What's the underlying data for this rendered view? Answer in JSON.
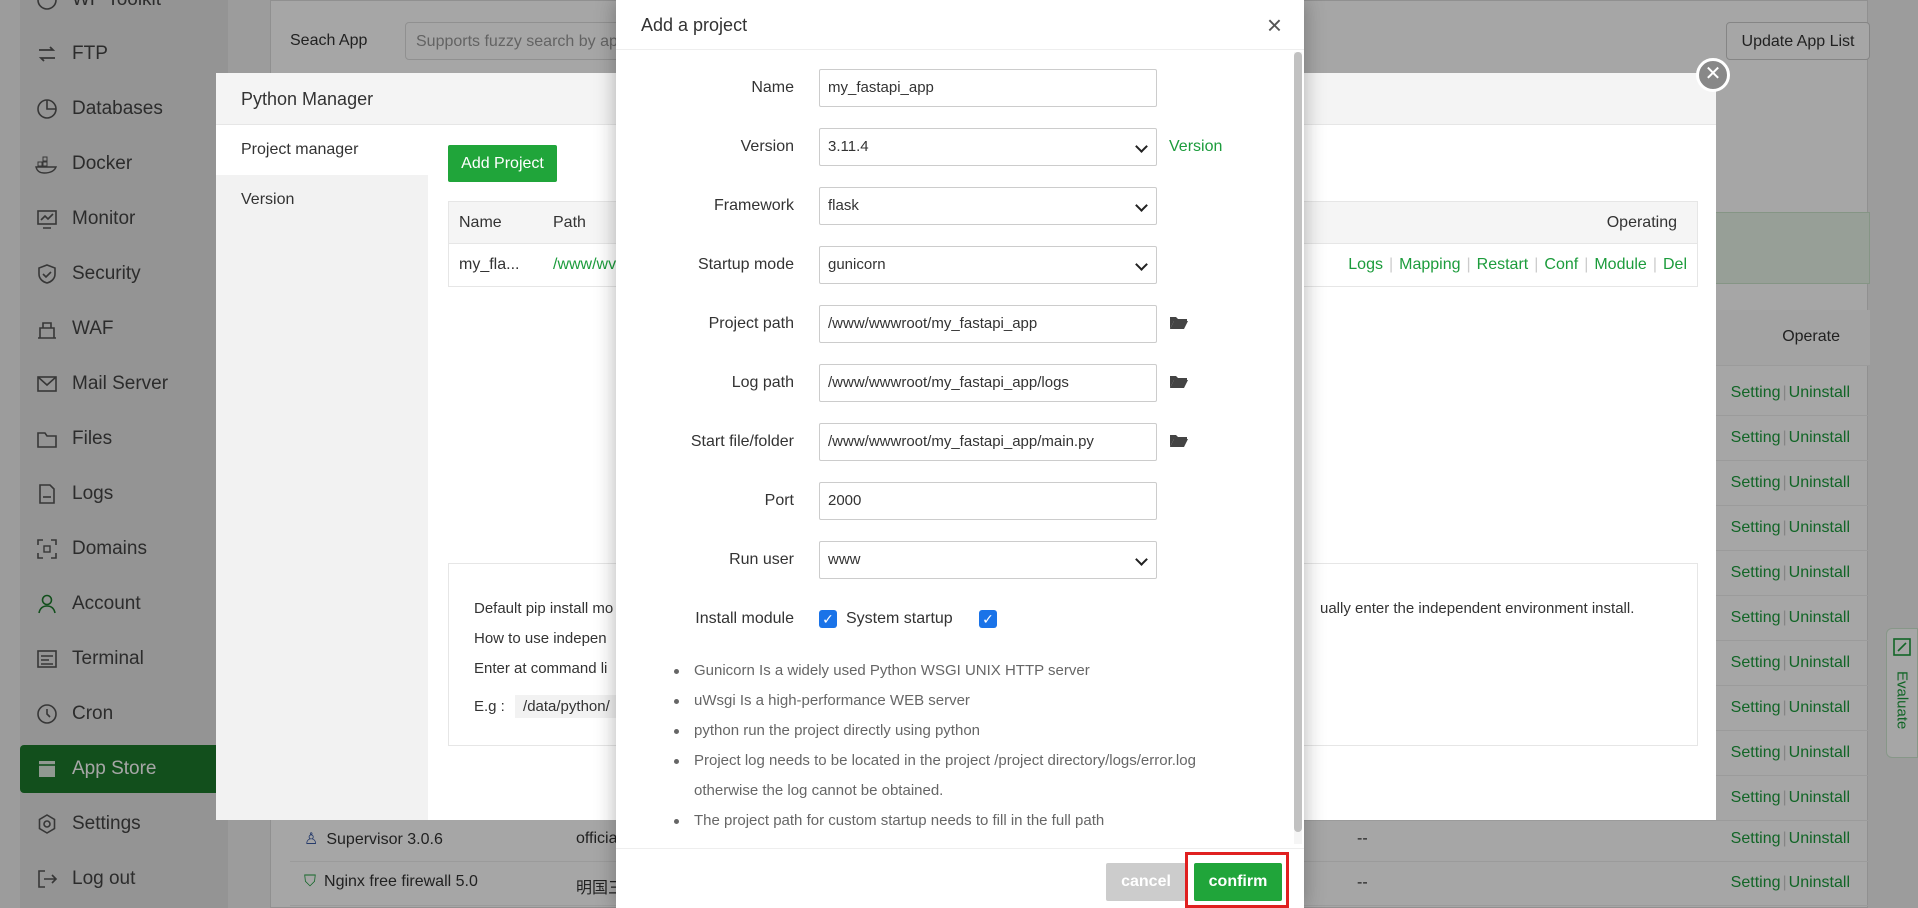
{
  "sidebar": {
    "items": [
      {
        "label": "WP Toolkit",
        "icon": "wordpress-icon"
      },
      {
        "label": "FTP",
        "icon": "ftp-icon"
      },
      {
        "label": "Databases",
        "icon": "database-icon"
      },
      {
        "label": "Docker",
        "icon": "docker-icon"
      },
      {
        "label": "Monitor",
        "icon": "monitor-icon"
      },
      {
        "label": "Security",
        "icon": "shield-icon"
      },
      {
        "label": "WAF",
        "icon": "waf-icon"
      },
      {
        "label": "Mail Server",
        "icon": "mail-icon"
      },
      {
        "label": "Files",
        "icon": "folder-icon"
      },
      {
        "label": "Logs",
        "icon": "logs-icon"
      },
      {
        "label": "Domains",
        "icon": "domains-icon"
      },
      {
        "label": "Account",
        "icon": "user-icon"
      },
      {
        "label": "Terminal",
        "icon": "terminal-icon"
      },
      {
        "label": "Cron",
        "icon": "clock-icon"
      },
      {
        "label": "App Store",
        "icon": "store-icon",
        "active": true
      },
      {
        "label": "Settings",
        "icon": "gear-icon"
      },
      {
        "label": "Log out",
        "icon": "logout-icon"
      }
    ]
  },
  "appstore": {
    "search_label": "Seach App",
    "search_placeholder": "Supports fuzzy search by ap",
    "update_label": "Update App List",
    "operate_header": "Operate",
    "setting_label": "Setting",
    "uninstall_label": "Uninstall",
    "rows": [
      {
        "name": "Supervisor 3.0.6",
        "dev": "officia",
        "status": "--"
      },
      {
        "name": "Nginx free firewall 5.0",
        "dev": "明国三",
        "status": "--"
      }
    ],
    "evaluate_label": "Evaluate"
  },
  "python_manager": {
    "title": "Python Manager",
    "tabs": [
      "Project manager",
      "Version"
    ],
    "add_project_label": "Add Project",
    "table": {
      "headers": {
        "name": "Name",
        "path": "Path",
        "operating": "Operating"
      },
      "row": {
        "name": "my_fla...",
        "path": "/www/wv"
      },
      "links": [
        "Logs",
        "Mapping",
        "Restart",
        "Conf",
        "Module",
        "Del"
      ]
    },
    "info": {
      "line1_start": "Default pip install mo",
      "line1_end": "ually enter the independent environment install.",
      "line2": "How to use indepen",
      "line3": "Enter at command li",
      "eg_label": "E.g :",
      "eg_value": "/data/python/"
    }
  },
  "dialog": {
    "title": "Add a project",
    "fields": {
      "name": {
        "label": "Name",
        "value": "my_fastapi_app"
      },
      "version": {
        "label": "Version",
        "value": "3.11.4",
        "link": "Version"
      },
      "framework": {
        "label": "Framework",
        "value": "flask"
      },
      "startup_mode": {
        "label": "Startup mode",
        "value": "gunicorn"
      },
      "project_path": {
        "label": "Project path",
        "value": "/www/wwwroot/my_fastapi_app"
      },
      "log_path": {
        "label": "Log path",
        "value": "/www/wwwroot/my_fastapi_app/logs"
      },
      "start_file": {
        "label": "Start file/folder",
        "value": "/www/wwwroot/my_fastapi_app/main.py"
      },
      "port": {
        "label": "Port",
        "value": "2000"
      },
      "run_user": {
        "label": "Run user",
        "value": "www"
      },
      "install_module": {
        "label": "Install module",
        "checked": true
      },
      "system_startup": {
        "label": "System startup",
        "checked": true
      }
    },
    "tips": [
      "Gunicorn Is a widely used Python WSGI UNIX HTTP server",
      "uWsgi Is a high-performance WEB server",
      "python run the project directly using python",
      "Project log needs to be located in the project /project directory/logs/error.log otherwise the log cannot be obtained.",
      "The project path for custom startup needs to fill in the full path"
    ],
    "cancel_label": "cancel",
    "confirm_label": "confirm"
  },
  "colors": {
    "brand_green": "#20a53a",
    "link_green": "#1c9c3c",
    "highlight_red": "#e02020"
  }
}
